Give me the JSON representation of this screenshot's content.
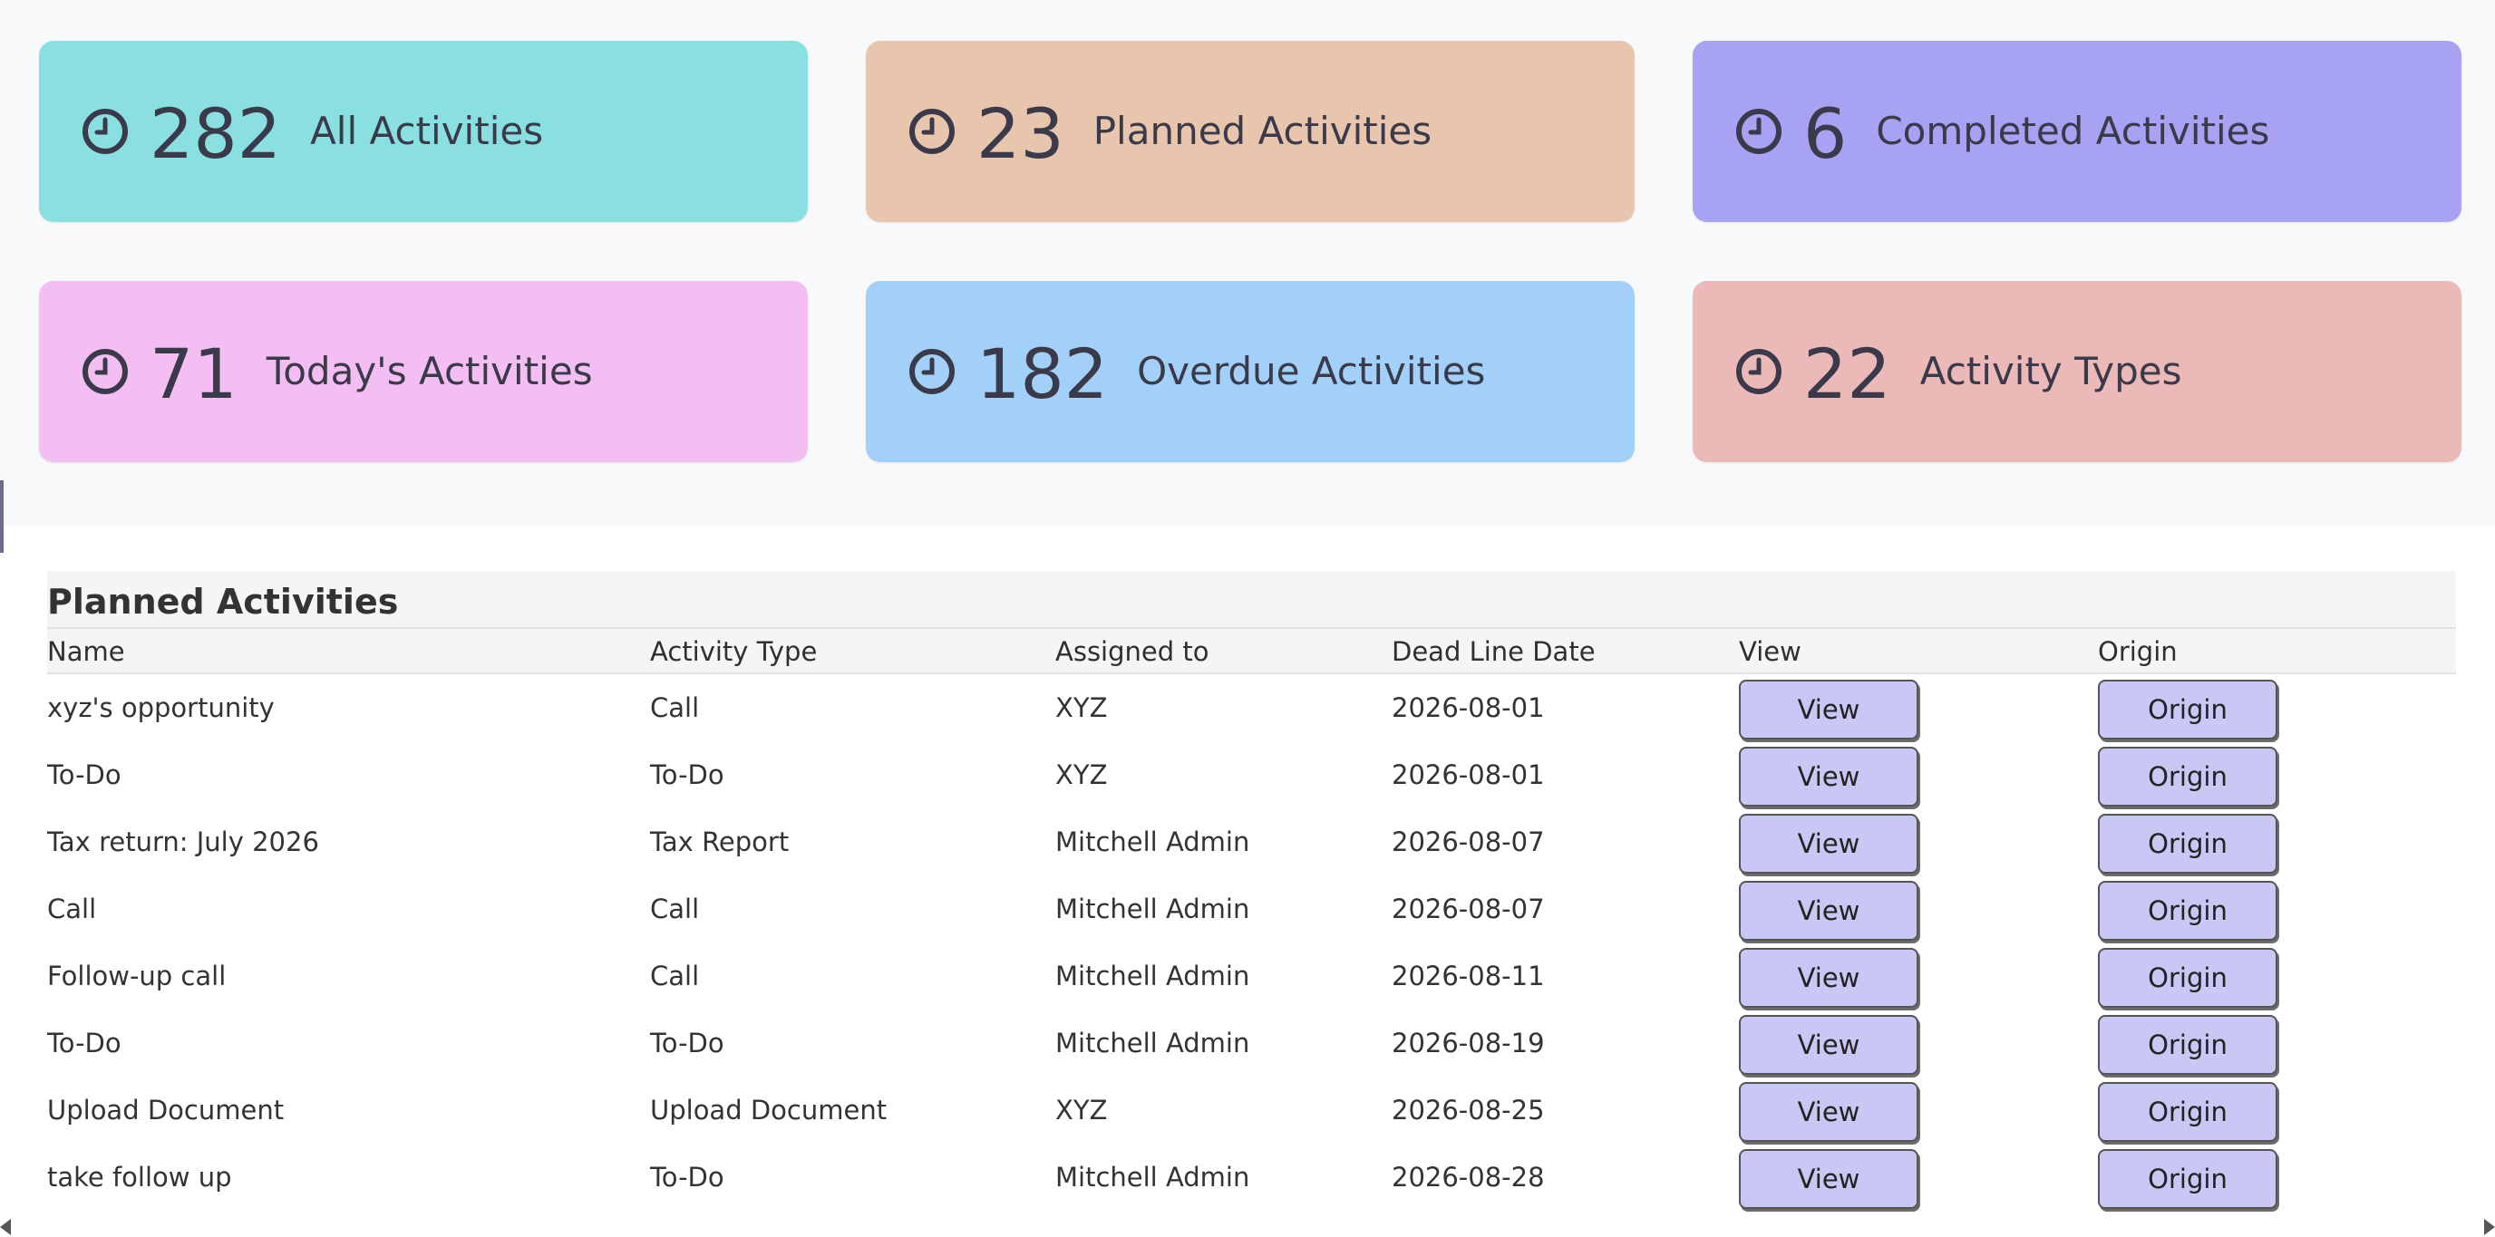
{
  "colors": {
    "all": "#8ae0e0",
    "planned": "#e8c5ad",
    "completed": "#a8a2f2",
    "today": "#f3bff3",
    "overdue": "#a3d0f8",
    "types": "#ebb9b7",
    "button": "#c9c7f3"
  },
  "cards": [
    {
      "icon": "clock-icon",
      "count": "282",
      "label": "All Activities"
    },
    {
      "icon": "clock-icon",
      "count": "23",
      "label": "Planned Activities"
    },
    {
      "icon": "clock-icon",
      "count": "6",
      "label": "Completed Activities"
    },
    {
      "icon": "clock-icon",
      "count": "71",
      "label": "Today's Activities"
    },
    {
      "icon": "clock-icon",
      "count": "182",
      "label": "Overdue Activities"
    },
    {
      "icon": "clock-icon",
      "count": "22",
      "label": "Activity Types"
    }
  ],
  "table": {
    "title": "Planned Activities",
    "columns": [
      "Name",
      "Activity Type",
      "Assigned to",
      "Dead Line Date",
      "View",
      "Origin"
    ],
    "view_label": "View",
    "origin_label": "Origin",
    "rows": [
      {
        "name": "xyz's opportunity",
        "type": "Call",
        "assigned": "XYZ",
        "date": "2026-08-01"
      },
      {
        "name": "To-Do",
        "type": "To-Do",
        "assigned": "XYZ",
        "date": "2026-08-01"
      },
      {
        "name": "Tax return: July 2026",
        "type": "Tax Report",
        "assigned": "Mitchell Admin",
        "date": "2026-08-07"
      },
      {
        "name": "Call",
        "type": "Call",
        "assigned": "Mitchell Admin",
        "date": "2026-08-07"
      },
      {
        "name": "Follow-up call",
        "type": "Call",
        "assigned": "Mitchell Admin",
        "date": "2026-08-11"
      },
      {
        "name": "To-Do",
        "type": "To-Do",
        "assigned": "Mitchell Admin",
        "date": "2026-08-19"
      },
      {
        "name": "Upload Document",
        "type": "Upload Document",
        "assigned": "XYZ",
        "date": "2026-08-25"
      },
      {
        "name": "take follow up",
        "type": "To-Do",
        "assigned": "Mitchell Admin",
        "date": "2026-08-28"
      }
    ]
  }
}
